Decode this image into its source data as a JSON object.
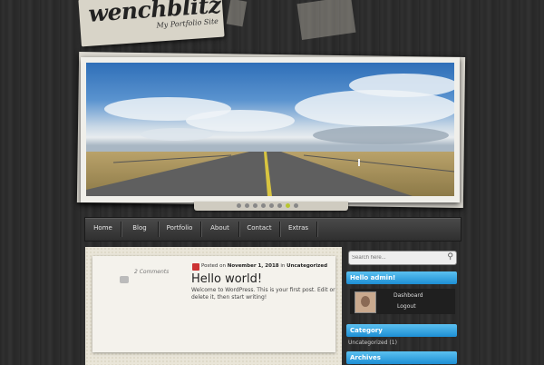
{
  "site": {
    "title": "wenchblitz",
    "tagline": "My Portfolio Site"
  },
  "slider": {
    "image": "highway-landscape-photo",
    "dots": 8,
    "active_dot": 7
  },
  "nav": {
    "items": [
      "Home",
      "Blog",
      "Portfolio",
      "About",
      "Contact",
      "Extras"
    ]
  },
  "post": {
    "comments": "2 Comments",
    "meta_prefix": "Posted on",
    "date": "November 1, 2018",
    "meta_mid": "in",
    "category": "Uncategorized",
    "title": "Hello world!",
    "excerpt": "Welcome to WordPress. This is your first post. Edit or delete it, then start writing!"
  },
  "sidebar": {
    "search_placeholder": "Search here...",
    "user_widget_title": "Hello admin!",
    "user_links": [
      "Dashboard",
      "Logout"
    ],
    "category_title": "Category",
    "category_item": "Uncategorized",
    "category_count": "(1)",
    "archives_title": "Archives"
  },
  "colors": {
    "accent_blue": "#1e8fd4",
    "background": "#2b2b2b",
    "active_dot": "#b8c530"
  }
}
